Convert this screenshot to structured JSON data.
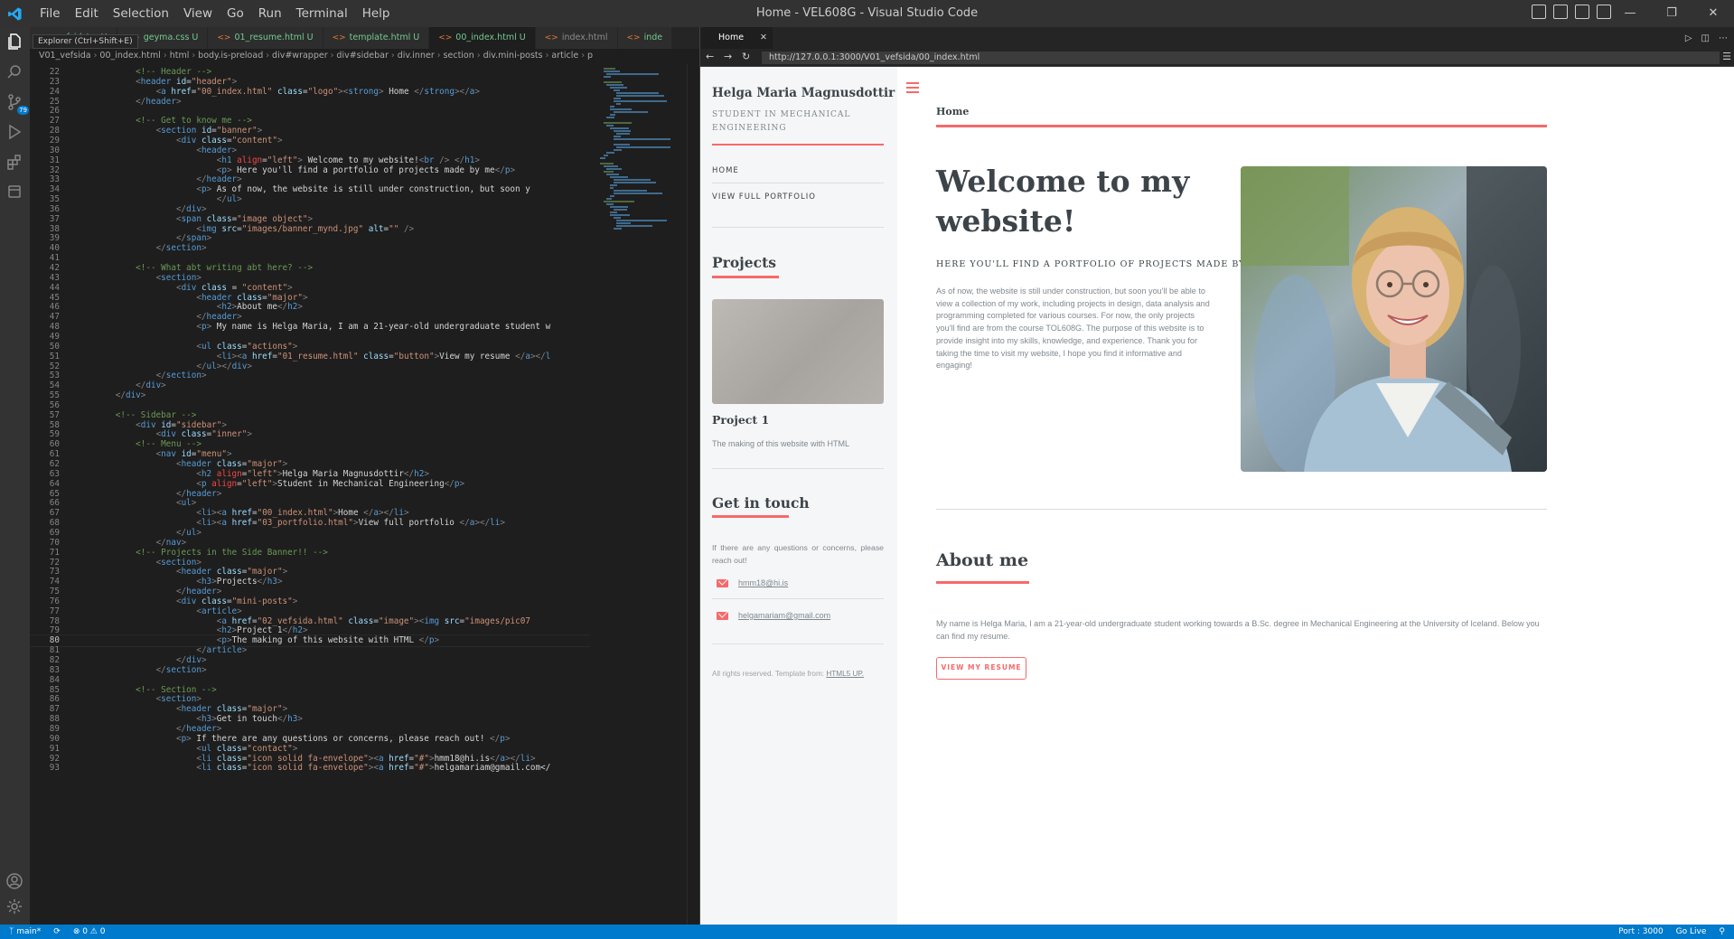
{
  "window": {
    "title": "Home - VEL608G - Visual Studio Code"
  },
  "menu": [
    "File",
    "Edit",
    "Selection",
    "View",
    "Go",
    "Run",
    "Terminal",
    "Help"
  ],
  "tooltip": "Explorer (Ctrl+Shift+E)",
  "scm_badge": "79",
  "tabs": [
    {
      "label": "vefsida\\... U",
      "state": "mod"
    },
    {
      "label": "geyma.css U",
      "state": "mod"
    },
    {
      "label": "01_resume.html U",
      "state": "mod"
    },
    {
      "label": "template.html U",
      "state": "mod"
    },
    {
      "label": "00_index.html U",
      "state": "active"
    },
    {
      "label": "index.html",
      "state": ""
    },
    {
      "label": "inde",
      "state": "mod"
    }
  ],
  "breadcrumb": [
    "V01_vefsida",
    "00_index.html",
    "html",
    "body.is-preload",
    "div#wrapper",
    "div#sidebar",
    "div.inner",
    "section",
    "div.mini-posts",
    "article",
    "p"
  ],
  "code": {
    "current_line": 80,
    "lines": [
      [
        22,
        "            <!-- Header -->"
      ],
      [
        23,
        "            <header id=\"header\">"
      ],
      [
        24,
        "                <a href=\"00_index.html\" class=\"logo\"><strong> Home </strong></a>"
      ],
      [
        25,
        "            </header>"
      ],
      [
        26,
        ""
      ],
      [
        27,
        "            <!-- Get to know me -->"
      ],
      [
        28,
        "                <section id=\"banner\">"
      ],
      [
        29,
        "                    <div class=\"content\">"
      ],
      [
        30,
        "                        <header>"
      ],
      [
        31,
        "                            <h1 align=\"left\"> Welcome to my website!<br /> </h1>"
      ],
      [
        32,
        "                            <p> Here you'll find a portfolio of projects made by me</p>"
      ],
      [
        33,
        "                        </header>"
      ],
      [
        34,
        "                        <p> As of now, the website is still under construction, but soon y"
      ],
      [
        35,
        "                            </ul>"
      ],
      [
        36,
        "                    </div>"
      ],
      [
        37,
        "                    <span class=\"image object\">"
      ],
      [
        38,
        "                        <img src=\"images/banner_mynd.jpg\" alt=\"\" />"
      ],
      [
        39,
        "                    </span>"
      ],
      [
        40,
        "                </section>"
      ],
      [
        41,
        ""
      ],
      [
        42,
        "            <!-- What abt writing abt here? -->"
      ],
      [
        43,
        "                <section>"
      ],
      [
        44,
        "                    <div class = \"content\">"
      ],
      [
        45,
        "                        <header class=\"major\">"
      ],
      [
        46,
        "                            <h2>About me</h2>"
      ],
      [
        47,
        "                        </header>"
      ],
      [
        48,
        "                        <p> My name is Helga Maria, I am a 21-year-old undergraduate student w"
      ],
      [
        49,
        ""
      ],
      [
        50,
        "                        <ul class=\"actions\">"
      ],
      [
        51,
        "                            <li><a href=\"01_resume.html\" class=\"button\">View my resume </a></l"
      ],
      [
        52,
        "                        </ul></div>"
      ],
      [
        53,
        "                </section>"
      ],
      [
        54,
        "            </div>"
      ],
      [
        55,
        "        </div>"
      ],
      [
        56,
        ""
      ],
      [
        57,
        "        <!-- Sidebar -->"
      ],
      [
        58,
        "            <div id=\"sidebar\">"
      ],
      [
        59,
        "                <div class=\"inner\">"
      ],
      [
        60,
        "            <!-- Menu -->"
      ],
      [
        61,
        "                <nav id=\"menu\">"
      ],
      [
        62,
        "                    <header class=\"major\">"
      ],
      [
        63,
        "                        <h2 align=\"left\">Helga Maria Magnusdottir</h2>"
      ],
      [
        64,
        "                        <p align=\"left\">Student in Mechanical Engineering</p>"
      ],
      [
        65,
        "                    </header>"
      ],
      [
        66,
        "                    <ul>"
      ],
      [
        67,
        "                        <li><a href=\"00_index.html\">Home </a></li>"
      ],
      [
        68,
        "                        <li><a href=\"03_portfolio.html\">View full portfolio </a></li>"
      ],
      [
        69,
        "                    </ul>"
      ],
      [
        70,
        "                </nav>"
      ],
      [
        71,
        "            <!-- Projects in the Side Banner!! -->"
      ],
      [
        72,
        "                <section>"
      ],
      [
        73,
        "                    <header class=\"major\">"
      ],
      [
        74,
        "                        <h3>Projects</h3>"
      ],
      [
        75,
        "                    </header>"
      ],
      [
        76,
        "                    <div class=\"mini-posts\">"
      ],
      [
        77,
        "                        <article>"
      ],
      [
        78,
        "                            <a href=\"02_vefsida.html\" class=\"image\"><img src=\"images/pic07"
      ],
      [
        79,
        "                            <h2>Project 1</h2>"
      ],
      [
        80,
        "                            <p>The making of this website with HTML </p>"
      ],
      [
        81,
        "                        </article>"
      ],
      [
        82,
        "                    </div>"
      ],
      [
        83,
        "                </section>"
      ],
      [
        84,
        ""
      ],
      [
        85,
        "            <!-- Section -->"
      ],
      [
        86,
        "                <section>"
      ],
      [
        87,
        "                    <header class=\"major\">"
      ],
      [
        88,
        "                        <h3>Get in touch</h3>"
      ],
      [
        89,
        "                    </header>"
      ],
      [
        90,
        "                    <p> If there are any questions or concerns, please reach out! </p>"
      ],
      [
        91,
        "                        <ul class=\"contact\">"
      ],
      [
        92,
        "                        <li class=\"icon solid fa-envelope\"><a href=\"#\">hmm18@hi.is</a></li>"
      ],
      [
        93,
        "                        <li class=\"icon solid fa-envelope\"><a href=\"#\">helgamariam@gmail.com</"
      ]
    ]
  },
  "preview": {
    "tab_label": "Home",
    "url": "http://127.0.0.1:3000/V01_vefsida/00_index.html"
  },
  "site": {
    "sidebar": {
      "name": "Helga Maria Magnusdottir",
      "role": "STUDENT IN MECHANICAL ENGINEERING",
      "nav": [
        "HOME",
        "VIEW FULL PORTFOLIO"
      ],
      "projects_heading": "Projects",
      "project_title": "Project 1",
      "project_desc": "The making of this website with HTML",
      "contact_heading": "Get in touch",
      "contact_text": "If there are any questions or concerns, please reach out!",
      "emails": [
        "hmm18@hi.is",
        "helgamariam@gmail.com"
      ],
      "footer_text": "All rights reserved. Template from:",
      "footer_link": "HTML5 UP."
    },
    "main": {
      "header_title": "Home",
      "heading": "Welcome to my website!",
      "subheading": "HERE YOU'LL FIND A PORTFOLIO OF PROJECTS MADE BY ME",
      "intro": "As of now, the website is still under construction, but soon you'll be able to view a collection of my work, including projects in design, data analysis and programming completed for various courses. For now, the only projects you'll find are from the course TOL608G. The purpose of this website is to provide insight into my skills, knowledge, and experience. Thank you for taking the time to visit my website, I hope you find it informative and engaging!",
      "about_heading": "About me",
      "about_text": "My name is Helga Maria, I am a 21-year-old undergraduate student working towards a B.Sc. degree in Mechanical Engineering at the University of Iceland. Below you can find my resume.",
      "button_label": "VIEW MY RESUME"
    }
  },
  "status": {
    "branch": "main*",
    "problems": "⊗ 0 ⚠ 0",
    "port": "Port : 3000",
    "golive": "Go Live"
  },
  "colors": {
    "accent": "#f56a6a",
    "statusbar": "#007acc"
  }
}
